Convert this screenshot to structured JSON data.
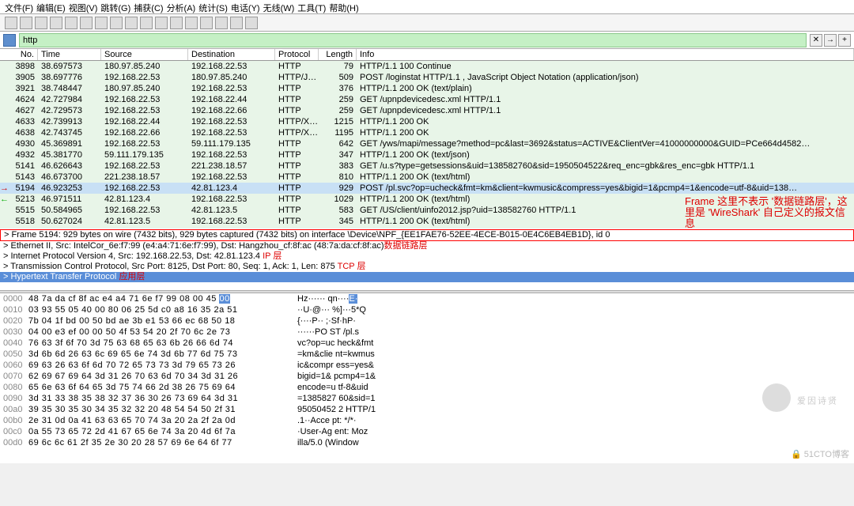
{
  "menu": [
    "文件(F)",
    "编辑(E)",
    "视图(V)",
    "跳转(G)",
    "捕获(C)",
    "分析(A)",
    "统计(S)",
    "电话(Y)",
    "无线(W)",
    "工具(T)",
    "帮助(H)"
  ],
  "filter": {
    "value": "http"
  },
  "columns": [
    "No.",
    "Time",
    "Source",
    "Destination",
    "Protocol",
    "Length",
    "Info"
  ],
  "packets": [
    {
      "no": "3898",
      "time": "38.697573",
      "src": "180.97.85.240",
      "dst": "192.168.22.53",
      "proto": "HTTP",
      "len": "79",
      "info": "HTTP/1.1 100 Continue"
    },
    {
      "no": "3905",
      "time": "38.697776",
      "src": "192.168.22.53",
      "dst": "180.97.85.240",
      "proto": "HTTP/J…",
      "len": "509",
      "info": "POST /loginstat HTTP/1.1 , JavaScript Object Notation (application/json)"
    },
    {
      "no": "3921",
      "time": "38.748447",
      "src": "180.97.85.240",
      "dst": "192.168.22.53",
      "proto": "HTTP",
      "len": "376",
      "info": "HTTP/1.1 200 OK  (text/plain)"
    },
    {
      "no": "4624",
      "time": "42.727984",
      "src": "192.168.22.53",
      "dst": "192.168.22.44",
      "proto": "HTTP",
      "len": "259",
      "info": "GET /upnpdevicedesc.xml HTTP/1.1"
    },
    {
      "no": "4627",
      "time": "42.729573",
      "src": "192.168.22.53",
      "dst": "192.168.22.66",
      "proto": "HTTP",
      "len": "259",
      "info": "GET /upnpdevicedesc.xml HTTP/1.1"
    },
    {
      "no": "4633",
      "time": "42.739913",
      "src": "192.168.22.44",
      "dst": "192.168.22.53",
      "proto": "HTTP/X…",
      "len": "1215",
      "info": "HTTP/1.1 200 OK"
    },
    {
      "no": "4638",
      "time": "42.743745",
      "src": "192.168.22.66",
      "dst": "192.168.22.53",
      "proto": "HTTP/X…",
      "len": "1195",
      "info": "HTTP/1.1 200 OK"
    },
    {
      "no": "4930",
      "time": "45.369891",
      "src": "192.168.22.53",
      "dst": "59.111.179.135",
      "proto": "HTTP",
      "len": "642",
      "info": "GET /yws/mapi/message?method=pc&last=3692&status=ACTIVE&ClientVer=41000000000&GUID=PCe664d4582…"
    },
    {
      "no": "4932",
      "time": "45.381770",
      "src": "59.111.179.135",
      "dst": "192.168.22.53",
      "proto": "HTTP",
      "len": "347",
      "info": "HTTP/1.1 200 OK  (text/json)"
    },
    {
      "no": "5141",
      "time": "46.626643",
      "src": "192.168.22.53",
      "dst": "221.238.18.57",
      "proto": "HTTP",
      "len": "383",
      "info": "GET /u.s?type=getsessions&uid=138582760&sid=1950504522&req_enc=gbk&res_enc=gbk HTTP/1.1"
    },
    {
      "no": "5143",
      "time": "46.673700",
      "src": "221.238.18.57",
      "dst": "192.168.22.53",
      "proto": "HTTP",
      "len": "810",
      "info": "HTTP/1.1 200 OK  (text/html)"
    },
    {
      "no": "5194",
      "time": "46.923253",
      "src": "192.168.22.53",
      "dst": "42.81.123.4",
      "proto": "HTTP",
      "len": "929",
      "info": "POST /pl.svc?op=ucheck&fmt=km&client=kwmusic&compress=yes&bigid=1&pcmp4=1&encode=utf-8&uid=138…",
      "sel": true
    },
    {
      "no": "5213",
      "time": "46.971511",
      "src": "42.81.123.4",
      "dst": "192.168.22.53",
      "proto": "HTTP",
      "len": "1029",
      "info": "HTTP/1.1 200 OK  (text/html)"
    },
    {
      "no": "5515",
      "time": "50.584965",
      "src": "192.168.22.53",
      "dst": "42.81.123.5",
      "proto": "HTTP",
      "len": "583",
      "info": "GET /US/client/uinfo2012.jsp?uid=138582760 HTTP/1.1"
    },
    {
      "no": "5518",
      "time": "50.627024",
      "src": "42.81.123.5",
      "dst": "192.168.22.53",
      "proto": "HTTP",
      "len": "345",
      "info": "HTTP/1.1 200 OK  (text/html)"
    }
  ],
  "tree": {
    "frame": "Frame 5194: 929 bytes on wire (7432 bits), 929 bytes captured (7432 bits) on interface \\Device\\NPF_{EE1FAE76-52EE-4ECE-B015-0E4C6EB4EB1D}, id 0",
    "eth": "Ethernet II, Src: IntelCor_6e:f7:99 (e4:a4:71:6e:f7:99), Dst: Hangzhou_cf:8f:ac (48:7a:da:cf:8f:ac)",
    "ip": "Internet Protocol Version 4, Src: 192.168.22.53, Dst: 42.81.123.4",
    "tcp": "Transmission Control Protocol, Src Port: 8125, Dst Port: 80, Seq: 1, Ack: 1, Len: 875",
    "app": "Hypertext Transfer Protocol"
  },
  "tree_anno": {
    "eth": "数据链路层",
    "ip": "IP 层",
    "tcp": "TCP 层",
    "app": "应用层"
  },
  "right_anno": "Frame 这里不表示 '数据链路层'，这里是 'WireShark' 自己定义的报文信息",
  "hex": [
    {
      "a": "0000",
      "b": "48 7a da cf 8f ac e4 a4  71 6e f7 99 08 00 45 00",
      "t": "Hz······ qn····E·"
    },
    {
      "a": "0010",
      "b": "03 93 55 05 40 00 80 06  25 5d c0 a8 16 35 2a 51",
      "t": "··U·@··· %]···5*Q"
    },
    {
      "a": "0020",
      "b": "7b 04 1f bd 00 50 bd ae  3b e1 53 66 ec 68 50 18",
      "t": "{····P·· ;·Sf·hP·"
    },
    {
      "a": "0030",
      "b": "04 00 e3 ef 00 00 50 4f  53 54 20 2f 70 6c 2e 73",
      "t": "······PO ST /pl.s"
    },
    {
      "a": "0040",
      "b": "76 63 3f 6f 70 3d 75 63  68 65 63 6b 26 66 6d 74",
      "t": "vc?op=uc heck&fmt"
    },
    {
      "a": "0050",
      "b": "3d 6b 6d 26 63 6c 69 65  6e 74 3d 6b 77 6d 75 73",
      "t": "=km&clie nt=kwmus"
    },
    {
      "a": "0060",
      "b": "69 63 26 63 6f 6d 70 72  65 73 73 3d 79 65 73 26",
      "t": "ic&compr ess=yes&"
    },
    {
      "a": "0070",
      "b": "62 69 67 69 64 3d 31 26  70 63 6d 70 34 3d 31 26",
      "t": "bigid=1& pcmp4=1&"
    },
    {
      "a": "0080",
      "b": "65 6e 63 6f 64 65 3d 75  74 66 2d 38 26 75 69 64",
      "t": "encode=u tf-8&uid"
    },
    {
      "a": "0090",
      "b": "3d 31 33 38 35 38 32 37  36 30 26 73 69 64 3d 31",
      "t": "=1385827 60&sid=1"
    },
    {
      "a": "00a0",
      "b": "39 35 30 35 30 34 35 32  32 20 48 54 54 50 2f 31",
      "t": "95050452 2 HTTP/1"
    },
    {
      "a": "00b0",
      "b": "2e 31 0d 0a 41 63 63 65  70 74 3a 20 2a 2f 2a 0d",
      "t": ".1··Acce pt: */*·"
    },
    {
      "a": "00c0",
      "b": "0a 55 73 65 72 2d 41 67  65 6e 74 3a 20 4d 6f 7a",
      "t": "·User-Ag ent: Moz"
    },
    {
      "a": "00d0",
      "b": "69 6c 6c 61 2f 35 2e 30  20 28 57 69 6e 64 6f 77",
      "t": "illa/5.0  (Window"
    }
  ],
  "watermark": "爱因诗贤",
  "blogmark": "🔒 51CTO博客"
}
